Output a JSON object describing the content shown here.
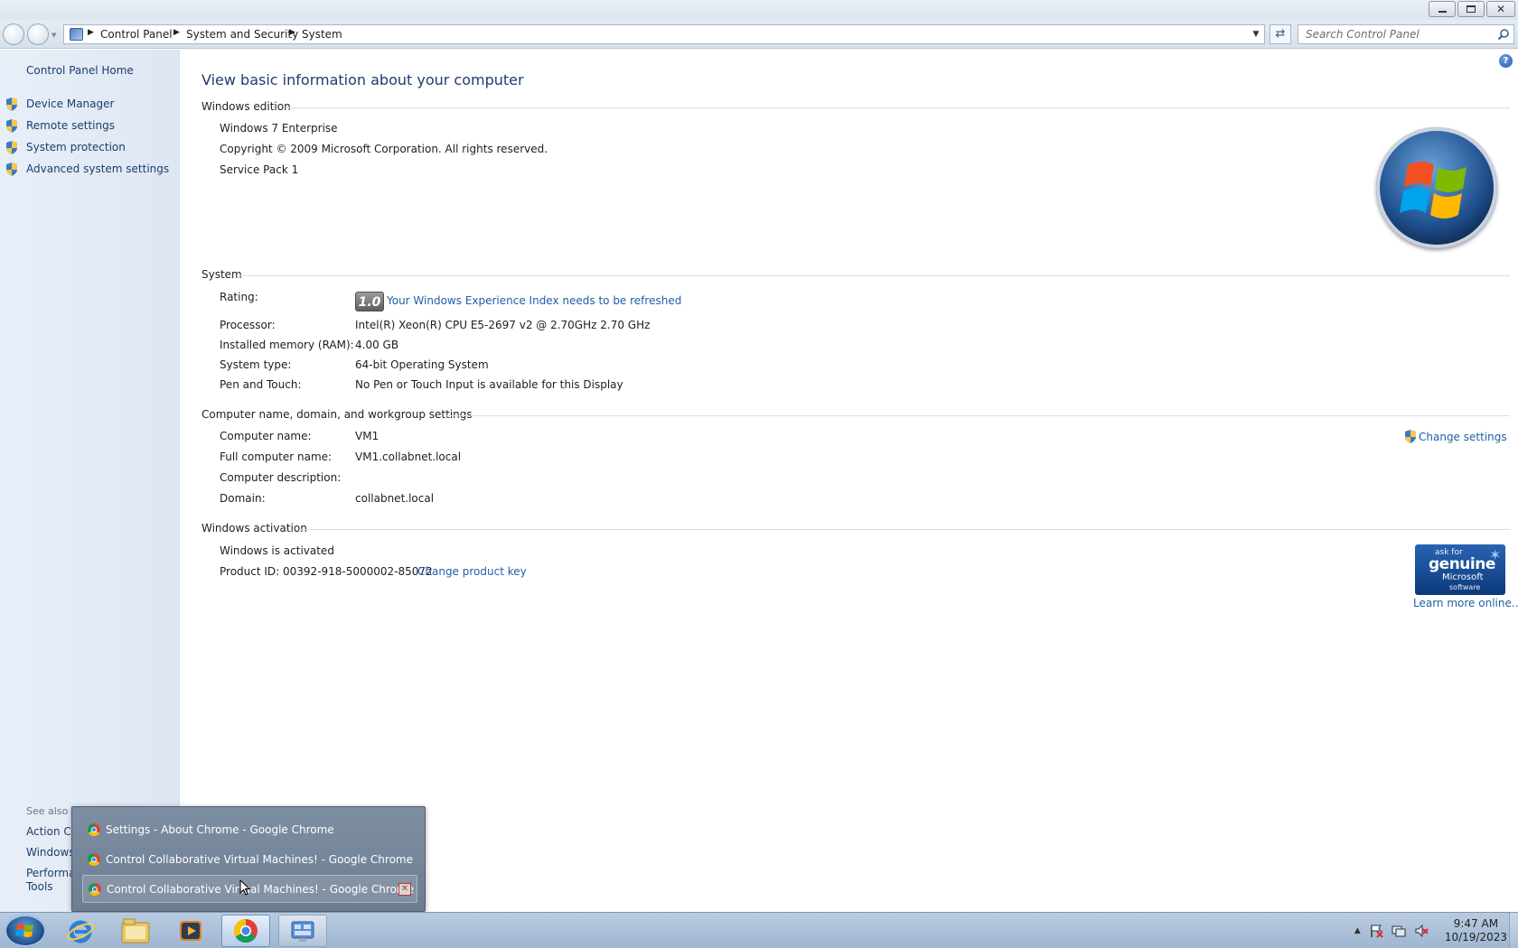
{
  "breadcrumb": [
    "Control Panel",
    "System and Security",
    "System"
  ],
  "search": {
    "placeholder": "Search Control Panel"
  },
  "left_pane": {
    "home": "Control Panel Home",
    "tasks": [
      "Device Manager",
      "Remote settings",
      "System protection",
      "Advanced system settings"
    ],
    "see_also_title": "See also",
    "see_also": [
      "Action Ce",
      "Windows",
      "Performa",
      "Tools"
    ]
  },
  "main": {
    "title": "View basic information about your computer",
    "edition": {
      "heading": "Windows edition",
      "name": "Windows 7 Enterprise",
      "copyright": "Copyright © 2009 Microsoft Corporation.  All rights reserved.",
      "service_pack": "Service Pack 1"
    },
    "system": {
      "heading": "System",
      "rating_label": "Rating:",
      "rating_score": "1.0",
      "rating_link": "Your Windows Experience Index needs to be refreshed",
      "processor_label": "Processor:",
      "processor": "Intel(R) Xeon(R) CPU E5-2697 v2 @ 2.70GHz   2.70 GHz",
      "ram_label": "Installed memory (RAM):",
      "ram": "4.00 GB",
      "type_label": "System type:",
      "type": "64-bit Operating System",
      "pen_label": "Pen and Touch:",
      "pen": "No Pen or Touch Input is available for this Display"
    },
    "computer": {
      "heading": "Computer name, domain, and workgroup settings",
      "change_settings": "Change settings",
      "name_label": "Computer name:",
      "name": "VM1",
      "full_label": "Full computer name:",
      "full": "VM1.collabnet.local",
      "desc_label": "Computer description:",
      "domain_label": "Domain:",
      "domain": "collabnet.local"
    },
    "activation": {
      "heading": "Windows activation",
      "status": "Windows is activated",
      "product_id": "Product ID: 00392-918-5000002-85072",
      "change_key": "Change product key",
      "genuine": [
        "ask for",
        "genuine",
        "Microsoft",
        "software"
      ],
      "learn_more": "Learn more online..."
    }
  },
  "jumplist": [
    "Settings - About Chrome - Google Chrome",
    "Control Collaborative Virtual Machines! - Google Chrome",
    "Control Collaborative Virtual Machines! - Google Chrome"
  ],
  "taskbar": {
    "apps": [
      "start-orb",
      "internet-explorer",
      "windows-explorer",
      "media-player",
      "google-chrome",
      "control-panel"
    ],
    "clock_time": "9:47 AM",
    "clock_date": "10/19/2023"
  }
}
